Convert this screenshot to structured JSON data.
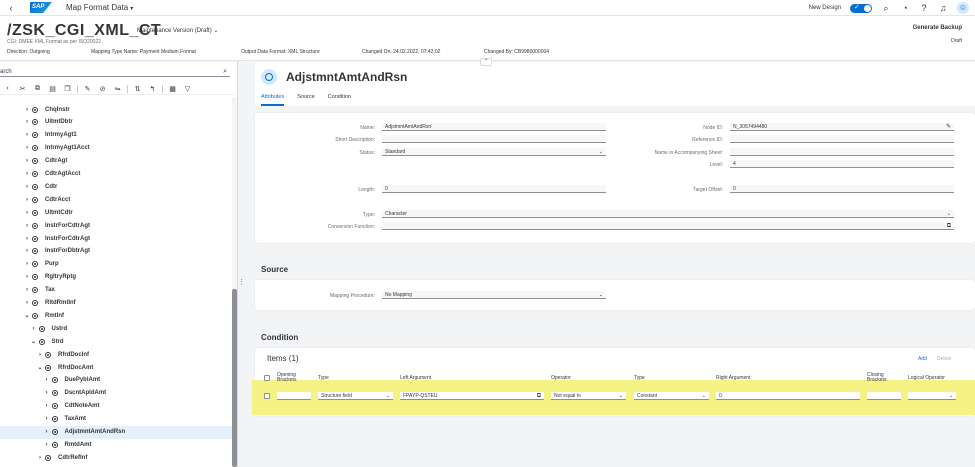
{
  "shell": {
    "app_title": "Map Format Data",
    "logo_text": "SAP",
    "new_design_label": "New Design"
  },
  "header": {
    "title": "/ZSK_CGI_XML_CT",
    "maintenance": "Maintenance Version (Draft)",
    "subtitle": "CGI: DMEE XML Format as per ISO20022",
    "direction": "Direction: Outgoing",
    "mapping_type": "Mapping Type Name: Payment Medium Format",
    "output_format": "Output Data Format: XML Structure",
    "changed_on": "Changed On: 24.02.2022, 07:42:02",
    "changed_by": "Changed By: CB9980000004",
    "generate_backup": "Generate Backup",
    "status": "Draft"
  },
  "left": {
    "search_value": "arch",
    "tree": [
      {
        "label": "ChqInstr",
        "level": 0,
        "expanded": false
      },
      {
        "label": "UltmtDbtr",
        "level": 0,
        "expanded": false
      },
      {
        "label": "IntrmyAgt1",
        "level": 0,
        "expanded": false
      },
      {
        "label": "IntrmyAgt1Acct",
        "level": 0,
        "expanded": false
      },
      {
        "label": "CdtrAgt",
        "level": 0,
        "expanded": false
      },
      {
        "label": "CdtrAgtAcct",
        "level": 0,
        "expanded": false
      },
      {
        "label": "Cdtr",
        "level": 0,
        "expanded": false
      },
      {
        "label": "CdtrAcct",
        "level": 0,
        "expanded": false
      },
      {
        "label": "UltmtCdtr",
        "level": 0,
        "expanded": false
      },
      {
        "label": "InstrForCdtrAgt",
        "level": 0,
        "expanded": false
      },
      {
        "label": "InstrForCdtrAgt",
        "level": 0,
        "expanded": false
      },
      {
        "label": "InstrForDbtrAgt",
        "level": 0,
        "expanded": false
      },
      {
        "label": "Purp",
        "level": 0,
        "expanded": false
      },
      {
        "label": "RgltryRptg",
        "level": 0,
        "expanded": false
      },
      {
        "label": "Tax",
        "level": 0,
        "expanded": false
      },
      {
        "label": "RltdRmtInf",
        "level": 0,
        "expanded": false
      },
      {
        "label": "RmtInf",
        "level": 0,
        "expanded": true
      },
      {
        "label": "Ustrd",
        "level": 1,
        "expanded": false
      },
      {
        "label": "Strd",
        "level": 1,
        "expanded": true
      },
      {
        "label": "RfrdDocInf",
        "level": 2,
        "expanded": false
      },
      {
        "label": "RfrdDocAmt",
        "level": 2,
        "expanded": true
      },
      {
        "label": "DuePyblAmt",
        "level": 3,
        "expanded": false
      },
      {
        "label": "DscntApldAmt",
        "level": 3,
        "expanded": false
      },
      {
        "label": "CdtNoteAmt",
        "level": 3,
        "expanded": false
      },
      {
        "label": "TaxAmt",
        "level": 3,
        "expanded": false
      },
      {
        "label": "AdjstmntAmtAndRsn",
        "level": 3,
        "expanded": false,
        "selected": true
      },
      {
        "label": "RmtdAmt",
        "level": 3,
        "expanded": false
      },
      {
        "label": "CdtrRefInf",
        "level": 2,
        "expanded": false
      }
    ]
  },
  "node": {
    "title": "AdjstmntAmtAndRsn",
    "tabs": [
      "Attributes",
      "Source",
      "Condition"
    ]
  },
  "attributes": {
    "name_label": "Name:",
    "name_value": "AdjstmntAmtAndRsn",
    "short_desc_label": "Short Description:",
    "short_desc_value": "",
    "status_label": "Status:",
    "status_value": "Standard",
    "node_id_label": "Node ID:",
    "node_id_value": "N_3057494480",
    "reference_id_label": "Reference ID:",
    "reference_id_value": "",
    "name_accomp_label": "Name in Accompanying Sheet:",
    "name_accomp_value": "",
    "level_label": "Level:",
    "level_value": "4",
    "length_label": "Length:",
    "length_value": "0",
    "target_offset_label": "Target Offset:",
    "target_offset_value": "0",
    "type_label": "Type:",
    "type_value": "Character",
    "conv_label": "Conversion Function:",
    "conv_value": ""
  },
  "source": {
    "title": "Source",
    "mapping_label": "Mapping Procedure:",
    "mapping_value": "No Mapping"
  },
  "condition": {
    "title": "Condition",
    "items_title": "Items (1)",
    "add": "Add",
    "delete": "Delete",
    "columns": {
      "opening": "Opening Brackets",
      "type": "Type",
      "left": "Left Argument",
      "operator": "Operator",
      "type2": "Type",
      "right": "Right Argument",
      "closing": "Closing Brackets",
      "logical": "Logical Operator"
    },
    "row": {
      "opening": "",
      "type": "Structure field",
      "left": "FPAYP-QSTEU",
      "operator": "Not equal to",
      "type2": "Constant",
      "right": "0",
      "closing": "",
      "logical": ""
    }
  },
  "colors": {
    "accent": "#0a6ed1",
    "highlight": "#f4f27a"
  }
}
